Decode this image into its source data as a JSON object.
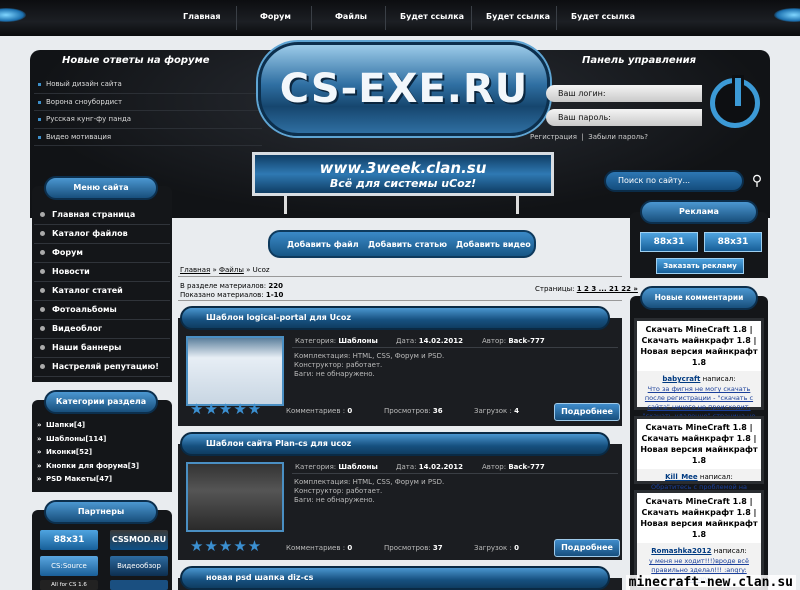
{
  "nav": [
    "Главная",
    "Форум",
    "Файлы",
    "Будет ссылка",
    "Будет ссылка",
    "Будет ссылка"
  ],
  "header": {
    "forum_title": "Новые ответы на форуме",
    "forum_items": [
      "Новый дизайн сайта",
      "Ворона сноубордист",
      "Русская кунг-фу панда",
      "Видео мотивация"
    ],
    "logo": "CS-EXE.RU",
    "panel_title": "Панель управления",
    "login_placeholder": "Ваш логин:",
    "password_placeholder": "Ваш пароль:",
    "register": "Регистрация",
    "sep": "|",
    "forgot": "Забыли пароль?",
    "banner_line1": "www.3week.clan.su",
    "banner_line2": "Всё для системы uCoz!",
    "search_placeholder": "Поиск по сайту...",
    "actions": [
      "Добавить файл",
      "Добавить статью",
      "Добавить видео"
    ]
  },
  "menu": {
    "title": "Меню сайта",
    "items": [
      "Главная страница",
      "Каталог файлов",
      "Форум",
      "Новости",
      "Каталог статей",
      "Фотоальбомы",
      "Видеоблог",
      "Наши баннеры",
      "Настреляй репутацию!"
    ]
  },
  "categories": {
    "title": "Категории раздела",
    "items": [
      "Шапки[4]",
      "Шаблоны[114]",
      "Иконки[52]",
      "Кнопки для форума[3]",
      "PSD Макеты[47]"
    ]
  },
  "partners": {
    "title": "Партнеры",
    "items": [
      "88x31",
      "CSSMOD.RU",
      "CS:Source",
      "Видеообзор",
      "All for CS 1.6",
      ""
    ]
  },
  "content": {
    "breadcrumb": {
      "home": "Главная",
      "sep": " » ",
      "files": "Файлы",
      "sep2": " » ",
      "current": "Ucoz"
    },
    "materials_in_section": "В разделе материалов: ",
    "materials_count": "220",
    "shown": "Показано материалов: ",
    "shown_range": "1-10",
    "pages_label": "Страницы: ",
    "pages": "1 2 3 ... 21 22 »",
    "entries": [
      {
        "title": "Шаблон logical-portal для Ucoz",
        "category_label": "Категория: ",
        "category": "Шаблоны",
        "date_label": "Дата: ",
        "date": "14.02.2012",
        "author_label": "Автор: ",
        "author": "Back-777",
        "desc1": "Комплектация: HTML, CSS, Форум и PSD.",
        "desc2": "Конструктор: работает.",
        "desc3": "Баги: не обнаружено.",
        "comments_label": "Комментариев : ",
        "comments": "0",
        "views_label": "Просмотров: ",
        "views": "36",
        "downloads_label": "Загрузок : ",
        "downloads": "4",
        "more": "Подробнее",
        "rating": 5
      },
      {
        "title": "Шаблон сайта Plan-cs для ucoz",
        "category_label": "Категория: ",
        "category": "Шаблоны",
        "date_label": "Дата: ",
        "date": "14.02.2012",
        "author_label": "Автор: ",
        "author": "Back-777",
        "desc1": "Комплектация: HTML, CSS, Форум и PSD.",
        "desc2": "Конструктор: работает.",
        "desc3": "Баги: не обнаружено.",
        "comments_label": "Комментариев : ",
        "comments": "0",
        "views_label": "Просмотров: ",
        "views": "37",
        "downloads_label": "Загрузок : ",
        "downloads": "0",
        "more": "Подробнее",
        "rating": 5
      },
      {
        "title": "новая psd шапка diz-cs"
      }
    ]
  },
  "ads": {
    "title": "Реклама",
    "btn1": "88x31",
    "btn2": "88x31",
    "order": "Заказать рекламу"
  },
  "comments": {
    "title": "Новые комментарии",
    "wrote": " написал:",
    "items": [
      {
        "title": "Скачать MineCraft 1.8 | Скачать майнкрафт 1.8 | Новая версия майнкрафт 1.8",
        "user": "babycraft",
        "text": "Что за фигня не могу скачать после регистрации - \"скачать с сайта\" ничего не происходит, \"скачать удаленно\" страница не грузится!!!"
      },
      {
        "title": "Скачать MineCraft 1.8 | Скачать майнкрафт 1.8 | Новая версия майнкрафт 1.8",
        "user": "Kill_Mee",
        "text": "Обратитесь с проблемой на форум"
      },
      {
        "title": "Скачать MineCraft 1.8 | Скачать майнкрафт 1.8 | Новая версия майнкрафт 1.8",
        "user": "Romashka2012",
        "text": "у меня не ходит!!!)вроде всё правильно зделал!!! :angry: :angry:"
      }
    ]
  },
  "watermark": "minecraft-new.clan.su",
  "colors": {
    "accent": "#2f79b3",
    "dark": "#141619",
    "bg": "#e9ecef"
  }
}
